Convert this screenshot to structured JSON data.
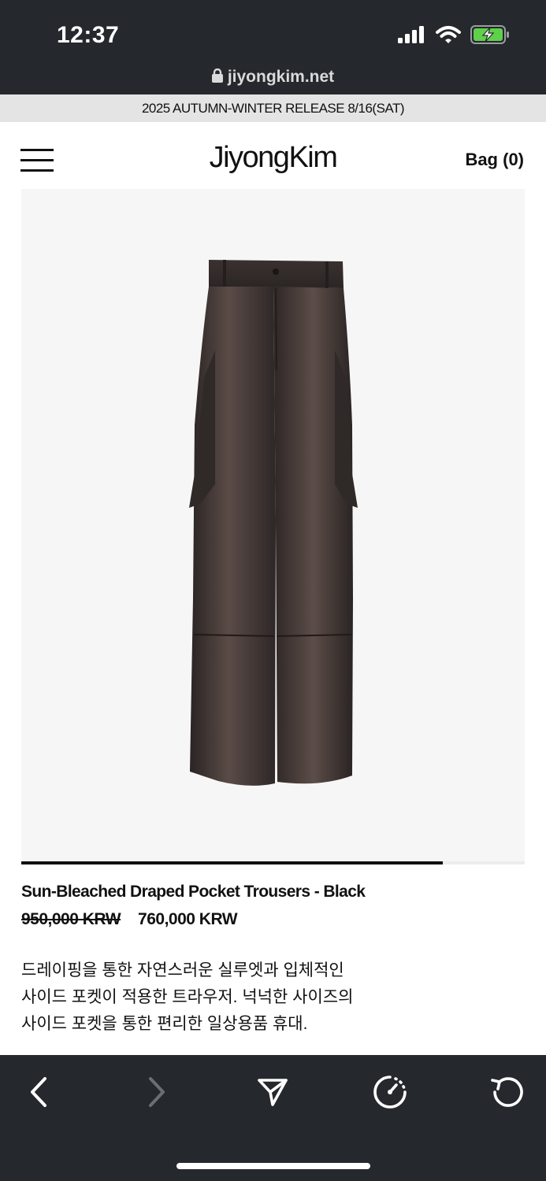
{
  "status_bar": {
    "time": "12:37",
    "icons": [
      "cellular-signal-icon",
      "wifi-icon",
      "battery-charging-icon"
    ]
  },
  "browser": {
    "url": "jiyongkim.net"
  },
  "promo": {
    "text": "2025 AUTUMN-WINTER RELEASE 8/16(SAT)"
  },
  "header": {
    "logo": "JiyongKim",
    "bag": "Bag (0)"
  },
  "product": {
    "image_alt": "trousers",
    "carousel_progress": 0.837,
    "name": "Sun-Bleached Draped Pocket Trousers - Black",
    "original_price": "950,000 KRW",
    "sale_price": "760,000 KRW",
    "description": [
      "드레이핑을 통한 자연스러운 실루엣과 입체적인",
      "사이드 포켓이 적용한 트라우저. 넉넉한 사이즈의",
      "사이드 포켓을 통한 편리한 일상용품 휴대."
    ]
  },
  "toolbar": {
    "icons": [
      "back-icon",
      "forward-icon",
      "share-icon",
      "speedometer-icon",
      "reload-icon"
    ]
  },
  "colors": {
    "chrome": "#25282c",
    "banner": "#e4e4e4",
    "image_bg": "#f6f6f6",
    "battery_green": "#5fd04a"
  }
}
